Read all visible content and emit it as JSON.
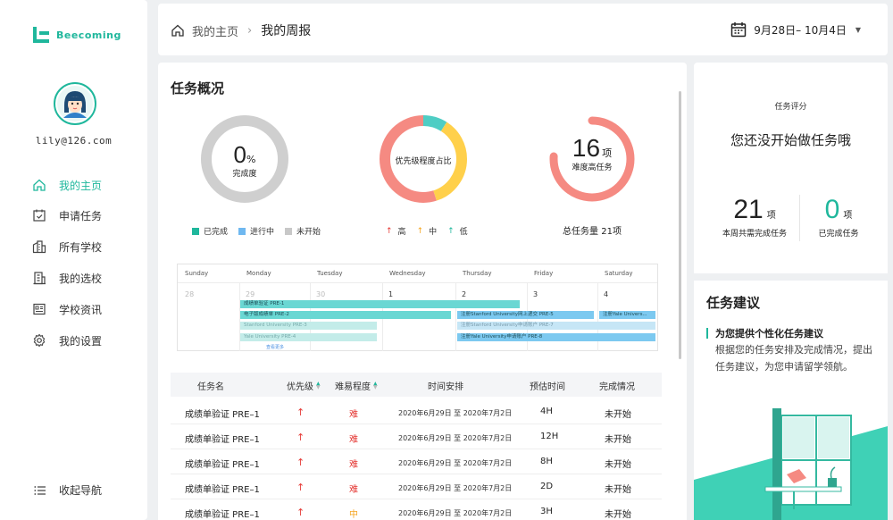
{
  "brand": {
    "name": "Beecoming",
    "color": "#1fb79c"
  },
  "user": {
    "email": "lily@126.com"
  },
  "nav": {
    "items": [
      {
        "label": "我的主页",
        "icon": "home-icon",
        "active": true
      },
      {
        "label": "申请任务",
        "icon": "calendar-check-icon",
        "active": false
      },
      {
        "label": "所有学校",
        "icon": "buildings-icon",
        "active": false
      },
      {
        "label": "我的选校",
        "icon": "building-icon",
        "active": false
      },
      {
        "label": "学校资讯",
        "icon": "news-icon",
        "active": false
      },
      {
        "label": "我的设置",
        "icon": "gear-icon",
        "active": false
      }
    ],
    "collapse_label": "收起导航"
  },
  "header": {
    "home": "我的主页",
    "current": "我的周报",
    "date_range": "9月28日– 10月4日"
  },
  "overview": {
    "title": "任务概况",
    "completion": {
      "value": "0",
      "unit": "%",
      "label": "完成度",
      "fraction": 0
    },
    "status_legend": [
      {
        "label": "已完成",
        "color": "#1fb79c"
      },
      {
        "label": "进行中",
        "color": "#6fb8f0"
      },
      {
        "label": "未开始",
        "color": "#c8c8c8"
      }
    ],
    "priority": {
      "label": "优先级程度占比",
      "legend": [
        {
          "label": "高",
          "color": "#e53935"
        },
        {
          "label": "中",
          "color": "#f5a623"
        },
        {
          "label": "低",
          "color": "#1fb79c"
        }
      ],
      "shares": [
        {
          "level": "高",
          "percent": 55,
          "color": "#f58a82"
        },
        {
          "level": "中",
          "percent": 36,
          "color": "#ffd04b"
        },
        {
          "level": "低",
          "percent": 9,
          "color": "#4ecdc4"
        }
      ]
    },
    "difficulty": {
      "value": "16",
      "unit": "项",
      "label": "难度高任务",
      "total_label": "总任务量 21项",
      "fraction": 0.76
    }
  },
  "calendar": {
    "weekdays": [
      "Sunday",
      "Monday",
      "Tuesday",
      "Wednesday",
      "Thursday",
      "Friday",
      "Saturday"
    ],
    "dates": [
      "28",
      "29",
      "30",
      "1",
      "2",
      "3",
      "4"
    ],
    "bars": [
      {
        "label": "成绩单验证  PRE-1",
        "color": "#6ad7d3"
      },
      {
        "label": "电子版成绩单  PRE-2",
        "color": "#6ad7d3"
      },
      {
        "label": "Stanford University  PRE-3",
        "color": "#c3ece9"
      },
      {
        "label": "Yale University  PRE-4",
        "color": "#c3ece9"
      },
      {
        "label": "注册Stanford University网上递交  PRE-5",
        "color": "#7cc9f0"
      },
      {
        "label": "注册Stanford University申请账户  PRE-7",
        "color": "#c6e6f6"
      },
      {
        "label": "注册Yale University申请账户  PRE-8",
        "color": "#7cc9f0"
      },
      {
        "label": "注册Yale Univers...",
        "color": "#7cc9f0"
      }
    ],
    "more": "查看更多"
  },
  "table": {
    "columns": [
      "任务名",
      "优先级",
      "难易程度",
      "时间安排",
      "预估时间",
      "完成情况"
    ],
    "rows": [
      {
        "name": "成绩单验证 PRE–1",
        "priority": "↑",
        "difficulty": "难",
        "time": "2020年6月29日 至 2020年7月2日",
        "estimate": "4H",
        "status": "未开始",
        "diff_color": "#e53935"
      },
      {
        "name": "成绩单验证 PRE–1",
        "priority": "↑",
        "difficulty": "难",
        "time": "2020年6月29日 至 2020年7月2日",
        "estimate": "12H",
        "status": "未开始",
        "diff_color": "#e53935"
      },
      {
        "name": "成绩单验证 PRE–1",
        "priority": "↑",
        "difficulty": "难",
        "time": "2020年6月29日 至 2020年7月2日",
        "estimate": "8H",
        "status": "未开始",
        "diff_color": "#e53935"
      },
      {
        "name": "成绩单验证 PRE–1",
        "priority": "↑",
        "difficulty": "难",
        "time": "2020年6月29日 至 2020年7月2日",
        "estimate": "2D",
        "status": "未开始",
        "diff_color": "#e53935"
      },
      {
        "name": "成绩单验证 PRE–1",
        "priority": "↑",
        "difficulty": "中",
        "time": "2020年6月29日 至 2020年7月2日",
        "estimate": "3H",
        "status": "未开始",
        "diff_color": "#f5a623"
      }
    ]
  },
  "score": {
    "title": "任务评分",
    "message": "您还没开始做任务哦",
    "weekly": {
      "value": "21",
      "unit": "项",
      "label": "本周共需完成任务"
    },
    "done": {
      "value": "0",
      "unit": "项",
      "label": "已完成任务"
    }
  },
  "suggestion": {
    "title": "任务建议",
    "headline": "为您提供个性化任务建议",
    "text": "根据您的任务安排及完成情况，提出任务建议，为您申请留学领航。"
  }
}
